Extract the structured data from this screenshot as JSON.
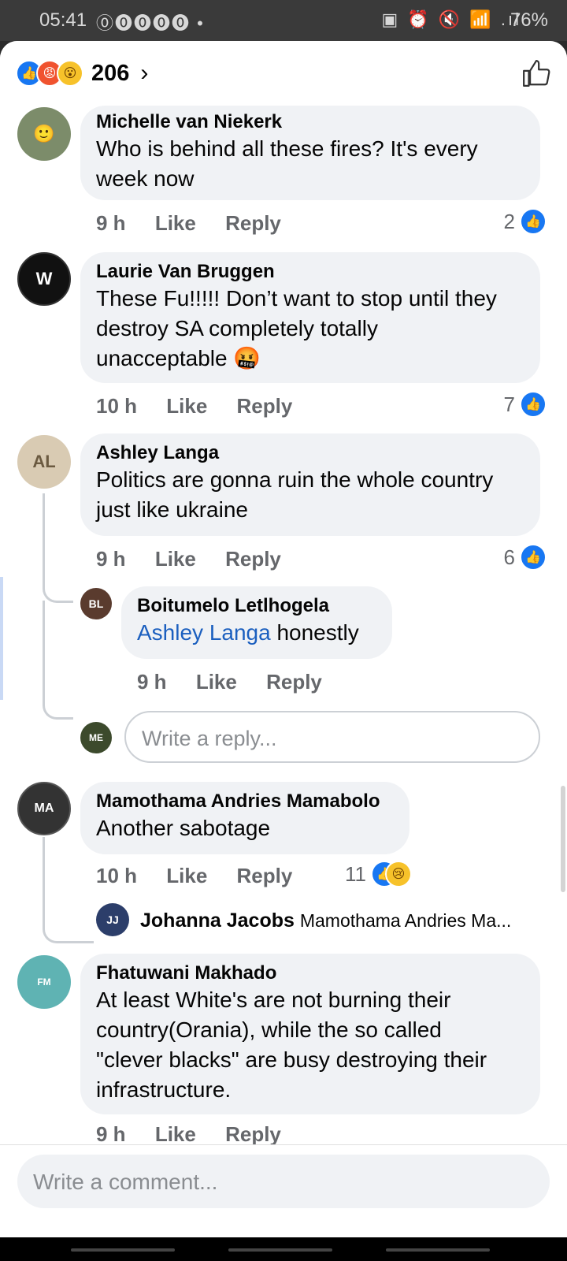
{
  "status": {
    "time": "05:41",
    "battery": "76%",
    "left_icons": "⓪⓿⓿⓿⓿ •",
    "right_icons": "▣ ⏰ 🔇 📶 .ıl"
  },
  "reactions": {
    "count": "206",
    "chevron": "›"
  },
  "comments": [
    {
      "name": "Michelle van Niekerk",
      "lines": [
        "Who is behind all these fires? It's every",
        "week now"
      ],
      "time": "9 h",
      "like": "Like",
      "reply": "Reply",
      "likes": "2"
    },
    {
      "name": "Laurie Van Bruggen",
      "lines": [
        "These Fu!!!!! Don’t want to stop until they",
        "destroy SA completely totally",
        "unacceptable 🤬"
      ],
      "time": "10 h",
      "like": "Like",
      "reply": "Reply",
      "likes": "7"
    },
    {
      "name": "Ashley Langa",
      "lines": [
        "Politics are gonna ruin the whole country",
        "just like ukraine"
      ],
      "time": "9 h",
      "like": "Like",
      "reply": "Reply",
      "likes": "6"
    },
    {
      "name": "Mamothama Andries Mamabolo",
      "lines": [
        "Another sabotage"
      ],
      "time": "10 h",
      "like": "Like",
      "reply": "Reply",
      "likes": "11"
    },
    {
      "name": "Fhatuwani Makhado",
      "lines": [
        "At least White's are not burning their",
        "country(Orania), while the so called",
        "\"clever blacks\" are busy destroying their",
        "infrastructure."
      ],
      "time": "9 h",
      "like": "Like",
      "reply": "Reply"
    }
  ],
  "reply_boitumelo": {
    "name": "Boitumelo Letlhogela",
    "mention": "Ashley Langa",
    "text": " honestly",
    "time": "9 h",
    "like": "Like",
    "reply": "Reply"
  },
  "reply_input": {
    "placeholder": "Write a reply..."
  },
  "johanna_preview": {
    "name": "Johanna Jacobs",
    "text": "Mamothama Andries Ma..."
  },
  "comment_input": {
    "placeholder": "Write a comment..."
  },
  "colors": {
    "accent": "#1877f2",
    "bubble": "#f0f2f5",
    "mention": "#1b5fbf"
  }
}
